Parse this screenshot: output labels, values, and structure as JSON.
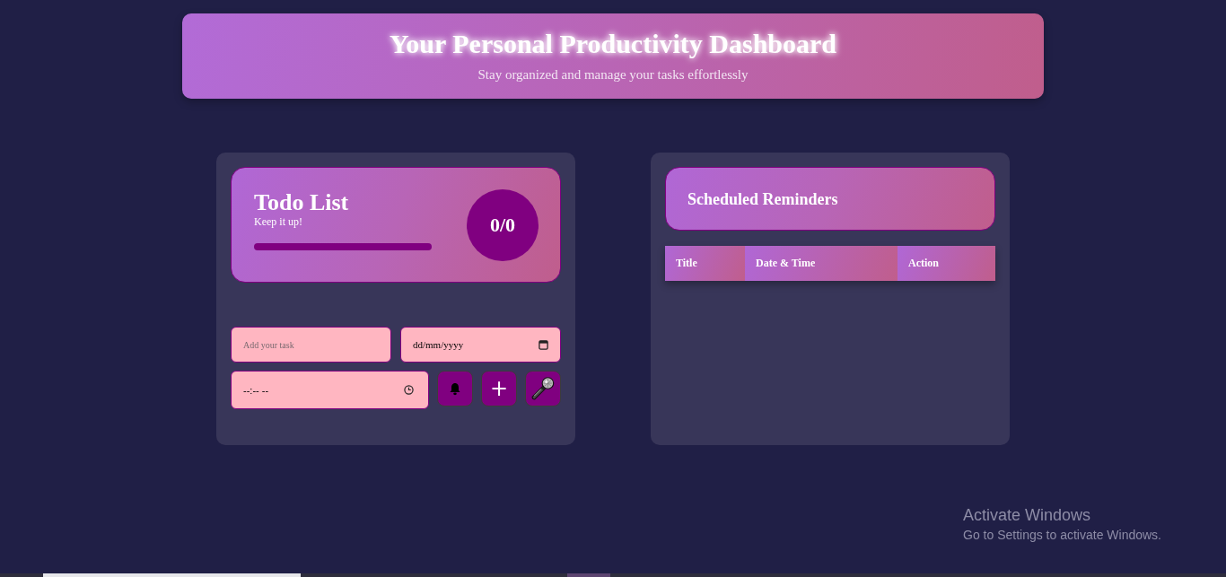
{
  "header": {
    "title": "Your Personal Productivity Dashboard",
    "subtitle": "Stay organized and manage your tasks effortlessly"
  },
  "todo": {
    "title": "Todo List",
    "message": "Keep it up!",
    "progress": {
      "level": 0
    },
    "counter": "0/0",
    "task_field": {
      "placeholder": "Add your task"
    },
    "date_field": {
      "placeholder": "dd/mm/yyyy"
    },
    "time_field": {
      "placeholder": "--:-- --"
    },
    "buttons": [
      {
        "kind": "bell"
      },
      {
        "kind": "add",
        "label": "+"
      },
      {
        "kind": "microphone"
      }
    ]
  },
  "reminders": {
    "title": "Scheduled Reminders",
    "table": {
      "columns": [
        "Title",
        "Date & Time",
        "Action"
      ]
    }
  },
  "system_notice": {
    "title": "Activate Windows",
    "text": "Go to Settings to activate Windows."
  }
}
